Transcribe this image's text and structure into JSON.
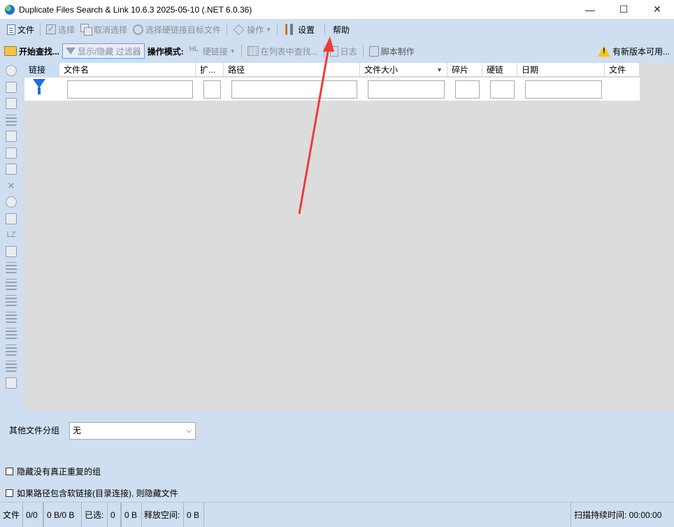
{
  "window": {
    "title": "Duplicate Files Search & Link 10.6.3 2025-05-10 (.NET 6.0.36)",
    "minimize": "—",
    "maximize": "☐",
    "close": "✕"
  },
  "toolbar1": {
    "file": "文件",
    "select": "选择",
    "deselect": "取消选择",
    "select_hardlink_target": "选择硬链接目标文件",
    "operations": "操作",
    "settings": "设置",
    "help": "帮助"
  },
  "toolbar2": {
    "start_search": "开始查找...",
    "toggle_filter": "显示/隐藏 过滤器",
    "op_mode_label": "操作模式:",
    "hardlink": "硬链接",
    "find_in_list": "在列表中查找...",
    "log": "日志",
    "script": "脚本制作",
    "update": "有新版本可用..."
  },
  "grid": {
    "columns": [
      "链接",
      "文件名",
      "扩...",
      "路径",
      "文件大小",
      "碎片",
      "硬链",
      "日期",
      "文件"
    ]
  },
  "bottom": {
    "group_label": "其他文件分组",
    "group_value": "无",
    "hide_no_dup": "隐藏没有真正重复的组",
    "hide_softlink": "如果路径包含软链接(目录连接), 则隐藏文件"
  },
  "status": {
    "files_label": "文件",
    "count": "0/0",
    "size": "0 B/0 B",
    "selected_label": "已选:",
    "selected_count": "0",
    "selected_size": "0 B",
    "free_label": "释放空间:",
    "free_value": "0 B",
    "scan_time": "扫描持续时间: 00:00:00"
  },
  "colors": {
    "background": "#cfdef0",
    "annotation_arrow": "#ee3b3b",
    "filter_funnel": "#1d6fd6"
  }
}
